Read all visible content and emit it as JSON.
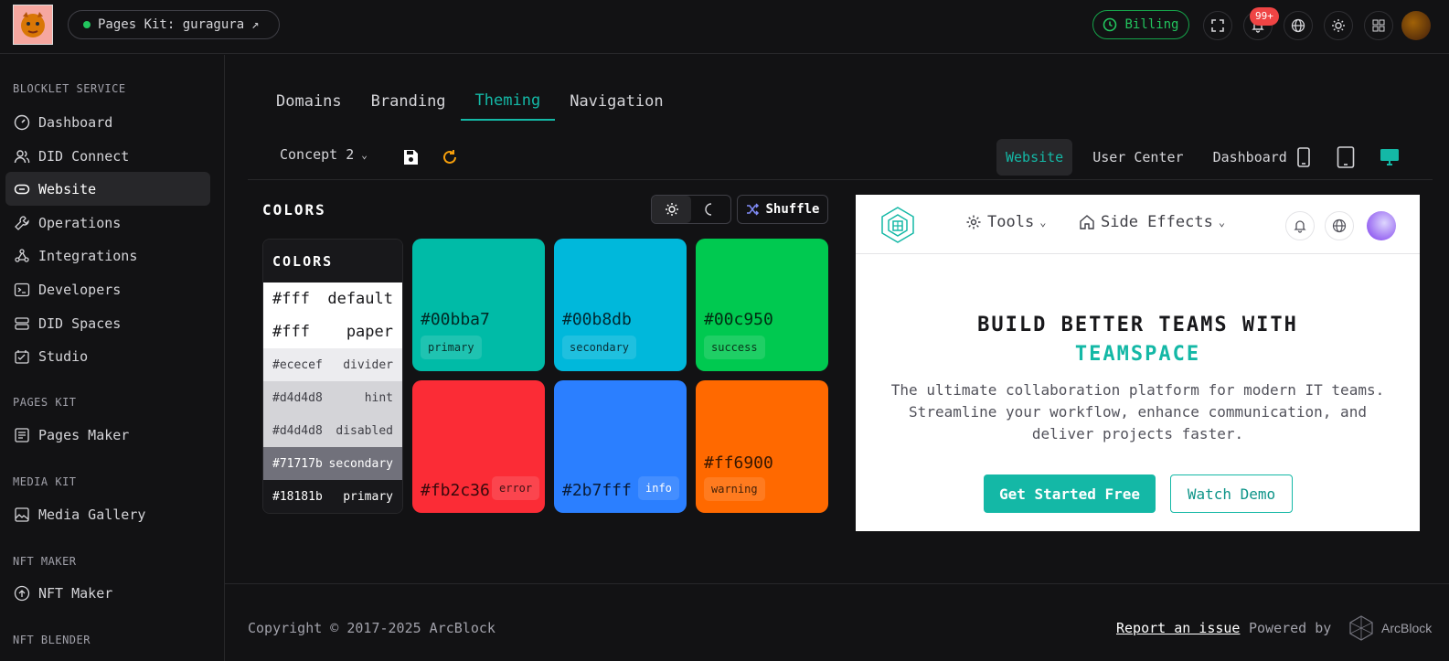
{
  "header": {
    "pill_label": "Pages Kit: guragura",
    "billing_label": "Billing",
    "notif_badge": "99+"
  },
  "sidebar": {
    "sections": [
      {
        "title": "BLOCKLET SERVICE"
      },
      {
        "title": "PAGES KIT"
      },
      {
        "title": "MEDIA KIT"
      },
      {
        "title": "NFT MAKER"
      },
      {
        "title": "NFT BLENDER"
      }
    ],
    "items": [
      {
        "label": "Dashboard",
        "icon": "gauge-icon"
      },
      {
        "label": "DID Connect",
        "icon": "users-icon"
      },
      {
        "label": "Website",
        "icon": "link-icon"
      },
      {
        "label": "Operations",
        "icon": "wrench-icon"
      },
      {
        "label": "Integrations",
        "icon": "webhook-icon"
      },
      {
        "label": "Developers",
        "icon": "terminal-icon"
      },
      {
        "label": "DID Spaces",
        "icon": "drive-icon"
      },
      {
        "label": "Studio",
        "icon": "checklist-icon"
      },
      {
        "label": "Pages Maker",
        "icon": "newspaper-icon"
      },
      {
        "label": "Media Gallery",
        "icon": "image-icon"
      },
      {
        "label": "NFT Maker",
        "icon": "upload-circle-icon"
      }
    ]
  },
  "tabs": [
    "Domains",
    "Branding",
    "Theming",
    "Navigation"
  ],
  "toolbar": {
    "concept": "Concept 2",
    "views": [
      "Website",
      "User Center",
      "Dashboard"
    ]
  },
  "colors": {
    "title": "COLORS",
    "shuffle_label": "Shuffle",
    "palette_title": "COLORS",
    "palette_rows": [
      {
        "hex": "#fff",
        "name": "default"
      },
      {
        "hex": "#fff",
        "name": "paper"
      },
      {
        "hex": "#ececef",
        "name": "divider"
      },
      {
        "hex": "#d4d4d8",
        "name": "hint"
      },
      {
        "hex": "#d4d4d8",
        "name": "disabled"
      },
      {
        "hex": "#71717b",
        "name": "secondary"
      },
      {
        "hex": "#18181b",
        "name": "primary"
      }
    ],
    "swatches": [
      {
        "hex": "#00bba7",
        "name": "primary"
      },
      {
        "hex": "#00b8db",
        "name": "secondary"
      },
      {
        "hex": "#00c950",
        "name": "success"
      },
      {
        "hex": "#fb2c36",
        "name": "error"
      },
      {
        "hex": "#2b7fff",
        "name": "info"
      },
      {
        "hex": "#ff6900",
        "name": "warning"
      }
    ]
  },
  "preview": {
    "menu_tools": "Tools",
    "menu_side": "Side Effects",
    "headline1": "BUILD BETTER TEAMS WITH",
    "headline2": "TEAMSPACE",
    "subtitle": "The ultimate collaboration platform for modern IT teams. Streamline your workflow, enhance communication, and deliver projects faster.",
    "cta_primary": "Get Started Free",
    "cta_secondary": "Watch Demo"
  },
  "footer": {
    "copyright": "Copyright © 2017-2025 ArcBlock",
    "report": "Report an issue",
    "powered_by": "Powered by",
    "brand": "ArcBlock"
  }
}
